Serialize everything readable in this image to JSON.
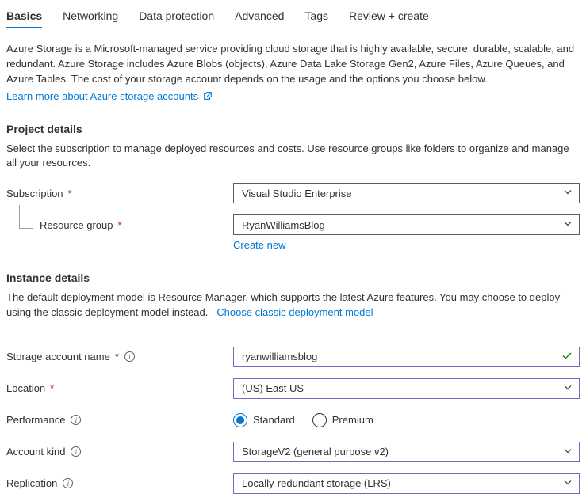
{
  "tabs": {
    "basics": "Basics",
    "networking": "Networking",
    "data_protection": "Data protection",
    "advanced": "Advanced",
    "tags": "Tags",
    "review": "Review + create"
  },
  "intro": {
    "text": "Azure Storage is a Microsoft-managed service providing cloud storage that is highly available, secure, durable, scalable, and redundant. Azure Storage includes Azure Blobs (objects), Azure Data Lake Storage Gen2, Azure Files, Azure Queues, and Azure Tables. The cost of your storage account depends on the usage and the options you choose below.",
    "link": "Learn more about Azure storage accounts"
  },
  "project": {
    "heading": "Project details",
    "desc": "Select the subscription to manage deployed resources and costs. Use resource groups like folders to organize and manage all your resources.",
    "subscription_label": "Subscription",
    "subscription_value": "Visual Studio Enterprise",
    "resource_group_label": "Resource group",
    "resource_group_value": "RyanWilliamsBlog",
    "create_new": "Create new"
  },
  "instance": {
    "heading": "Instance details",
    "desc_part1": "The default deployment model is Resource Manager, which supports the latest Azure features. You may choose to deploy using the classic deployment model instead.",
    "classic_link": "Choose classic deployment model",
    "storage_name_label": "Storage account name",
    "storage_name_value": "ryanwilliamsblog",
    "location_label": "Location",
    "location_value": "(US) East US",
    "performance_label": "Performance",
    "perf_standard": "Standard",
    "perf_premium": "Premium",
    "account_kind_label": "Account kind",
    "account_kind_value": "StorageV2 (general purpose v2)",
    "replication_label": "Replication",
    "replication_value": "Locally-redundant storage (LRS)"
  }
}
